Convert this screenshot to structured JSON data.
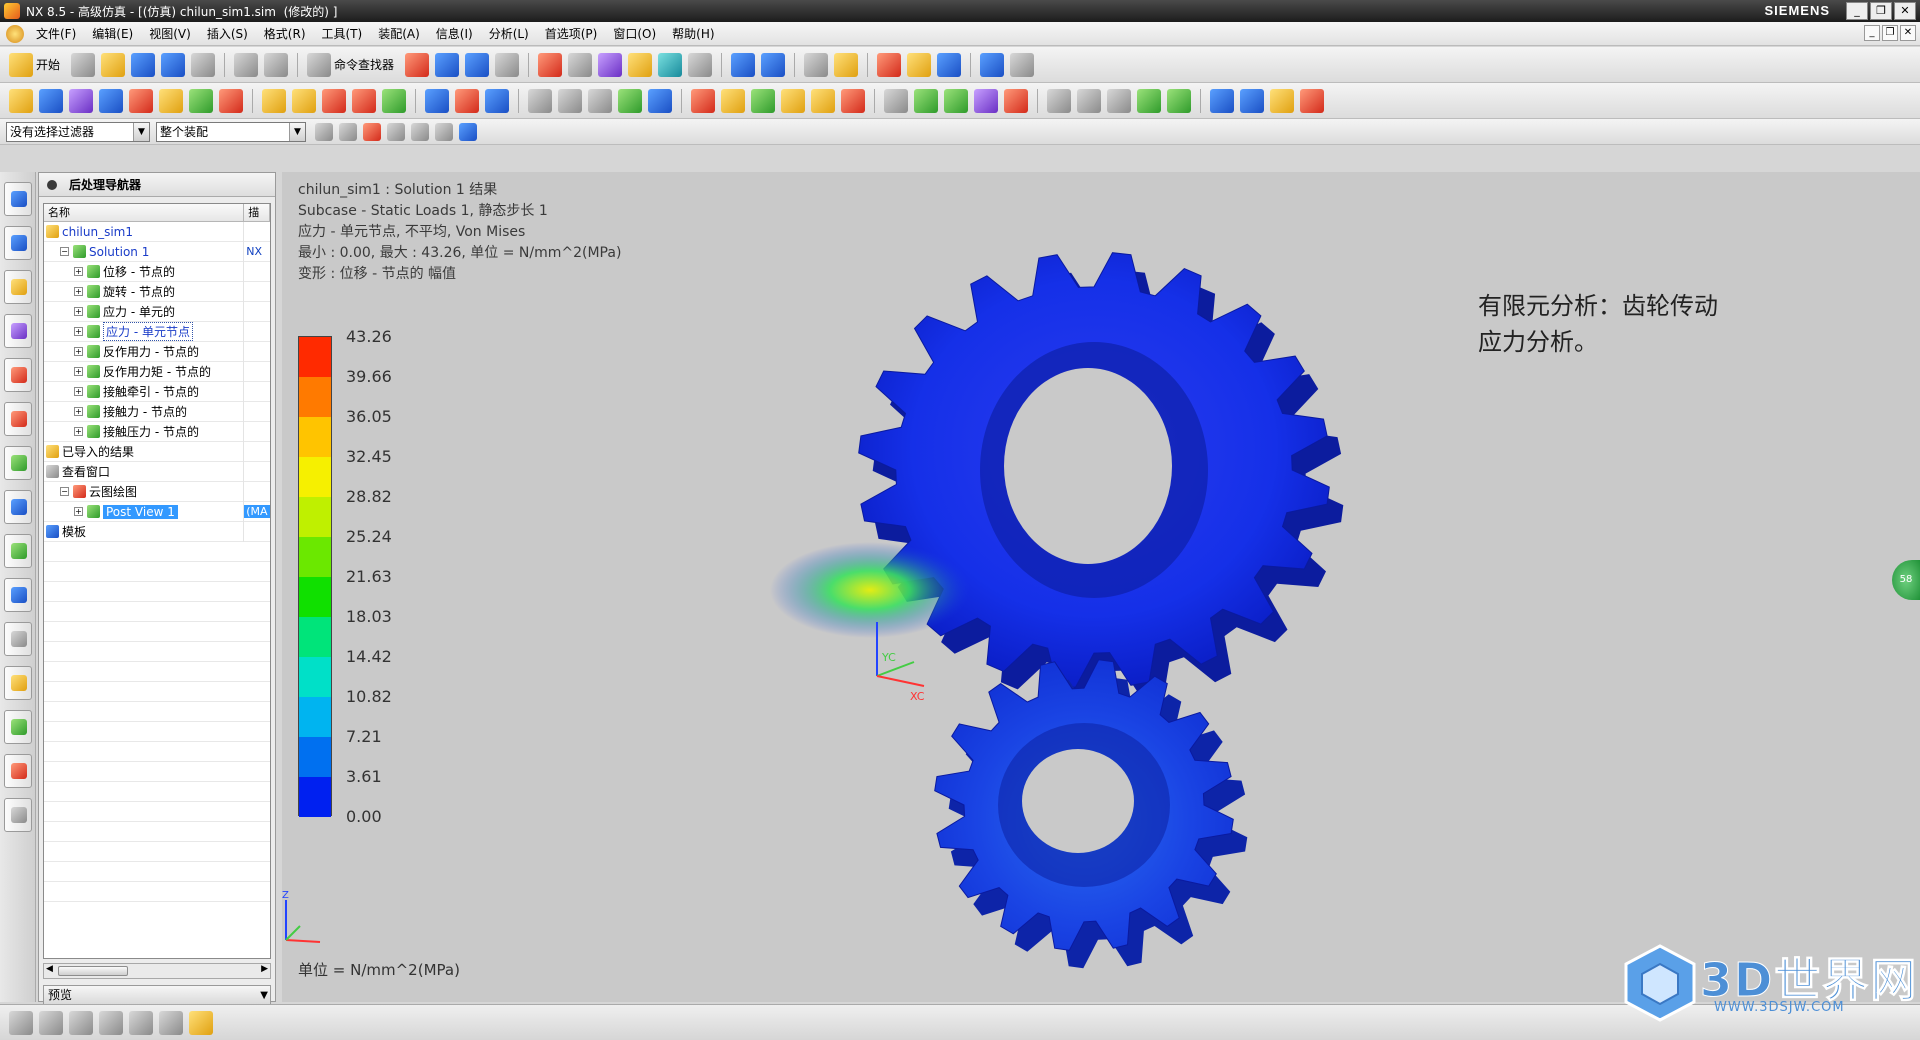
{
  "window": {
    "title": "NX 8.5 - 高级仿真 - [(仿真) chilun_sim1.sim  (修改的) ]",
    "brand": "SIEMENS"
  },
  "menu": [
    "文件(F)",
    "编辑(E)",
    "视图(V)",
    "插入(S)",
    "格式(R)",
    "工具(T)",
    "装配(A)",
    "信息(I)",
    "分析(L)",
    "首选项(P)",
    "窗口(O)",
    "帮助(H)"
  ],
  "toolbar": {
    "start_label": "开始",
    "command_finder_label": "命令查找器",
    "selection_filter": "没有选择过滤器",
    "assembly_scope": "整个装配"
  },
  "navigator": {
    "title": "后处理导航器",
    "col_name": "名称",
    "col_desc": "描述",
    "rows": [
      {
        "label": "chilun_sim1",
        "desc": "",
        "level": 0,
        "exp": ""
      },
      {
        "label": "Solution 1",
        "desc": "NX",
        "level": 1,
        "exp": "−"
      },
      {
        "label": "位移 - 节点的",
        "desc": "",
        "level": 2,
        "exp": "+"
      },
      {
        "label": "旋转 - 节点的",
        "desc": "",
        "level": 2,
        "exp": "+"
      },
      {
        "label": "应力 - 单元的",
        "desc": "",
        "level": 2,
        "exp": "+"
      },
      {
        "label": "应力 - 单元节点",
        "desc": "",
        "level": 2,
        "exp": "+"
      },
      {
        "label": "反作用力 - 节点的",
        "desc": "",
        "level": 2,
        "exp": "+"
      },
      {
        "label": "反作用力矩 - 节点的",
        "desc": "",
        "level": 2,
        "exp": "+"
      },
      {
        "label": "接触牵引 - 节点的",
        "desc": "",
        "level": 2,
        "exp": "+"
      },
      {
        "label": "接触力 - 节点的",
        "desc": "",
        "level": 2,
        "exp": "+"
      },
      {
        "label": "接触压力 - 节点的",
        "desc": "",
        "level": 2,
        "exp": "+"
      },
      {
        "label": "已导入的结果",
        "desc": "",
        "level": 0,
        "exp": ""
      },
      {
        "label": "查看窗口",
        "desc": "",
        "level": 0,
        "exp": ""
      },
      {
        "label": "云图绘图",
        "desc": "",
        "level": 1,
        "exp": "−"
      },
      {
        "label": "Post View 1",
        "desc": "(MA",
        "level": 2,
        "exp": "+"
      },
      {
        "label": "模板",
        "desc": "",
        "level": 0,
        "exp": ""
      }
    ],
    "preview_label": "预览"
  },
  "viewport": {
    "info_lines": [
      "chilun_sim1 : Solution 1 结果",
      "Subcase - Static Loads 1, 静态步长 1",
      "应力 - 单元节点, 不平均, Von Mises",
      "最小 : 0.00, 最大 : 43.26, 单位 = N/mm^2(MPa)",
      "变形 : 位移 - 节点的 幅值"
    ],
    "annotation": "有限元分析：齿轮传动应力分析。",
    "legend_values": [
      "43.26",
      "39.66",
      "36.05",
      "32.45",
      "28.82",
      "25.24",
      "21.63",
      "18.03",
      "14.42",
      "10.82",
      "7.21",
      "3.61",
      "0.00"
    ],
    "legend_colors": [
      "#ff2a00",
      "#ff7a00",
      "#ffc400",
      "#f6f000",
      "#bff000",
      "#6be800",
      "#10e000",
      "#00e47a",
      "#00e0c8",
      "#00b4f0",
      "#0070f0",
      "#0020f0"
    ],
    "unit_label": "单位 = N/mm^2(MPa)",
    "axes": {
      "x": "XC",
      "y": "YC",
      "z": "Z"
    }
  },
  "side_bubble": "58",
  "watermark": {
    "title": "3D世界网",
    "url": "WWW.3DSJW.COM"
  }
}
